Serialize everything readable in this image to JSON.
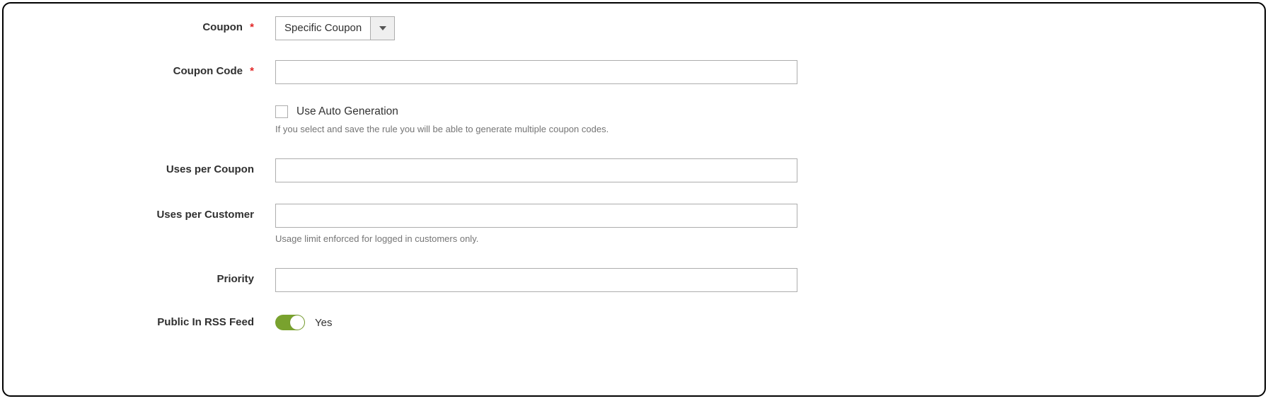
{
  "fields": {
    "coupon": {
      "label": "Coupon",
      "required_mark": "*",
      "selected": "Specific Coupon"
    },
    "coupon_code": {
      "label": "Coupon Code",
      "required_mark": "*",
      "value": ""
    },
    "auto_gen": {
      "checkbox_label": "Use Auto Generation",
      "helper": "If you select and save the rule you will be able to generate multiple coupon codes."
    },
    "uses_per_coupon": {
      "label": "Uses per Coupon",
      "value": ""
    },
    "uses_per_customer": {
      "label": "Uses per Customer",
      "value": "",
      "helper": "Usage limit enforced for logged in customers only."
    },
    "priority": {
      "label": "Priority",
      "value": ""
    },
    "rss": {
      "label": "Public In RSS Feed",
      "value_label": "Yes"
    }
  }
}
